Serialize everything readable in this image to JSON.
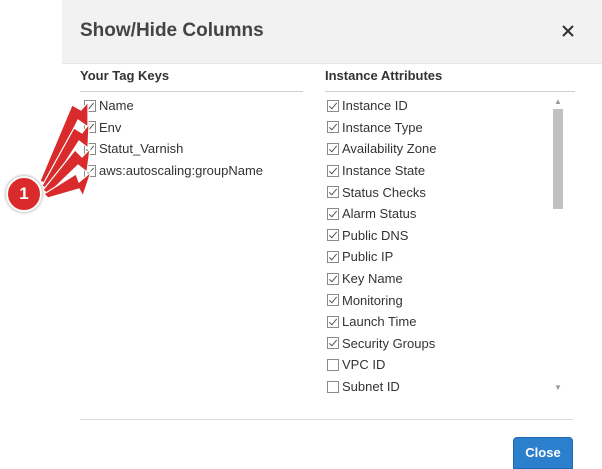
{
  "dialog": {
    "title": "Show/Hide Columns",
    "close_icon": "close-icon",
    "close_button_label": "Close"
  },
  "tag_keys": {
    "heading": "Your Tag Keys",
    "items": [
      {
        "label": "Name",
        "checked": true
      },
      {
        "label": "Env",
        "checked": true
      },
      {
        "label": "Statut_Varnish",
        "checked": true
      },
      {
        "label": "aws:autoscaling:groupName",
        "checked": true
      }
    ]
  },
  "instance_attributes": {
    "heading": "Instance Attributes",
    "items": [
      {
        "label": "Instance ID",
        "checked": true
      },
      {
        "label": "Instance Type",
        "checked": true
      },
      {
        "label": "Availability Zone",
        "checked": true
      },
      {
        "label": "Instance State",
        "checked": true
      },
      {
        "label": "Status Checks",
        "checked": true
      },
      {
        "label": "Alarm Status",
        "checked": true
      },
      {
        "label": "Public DNS",
        "checked": true
      },
      {
        "label": "Public IP",
        "checked": true
      },
      {
        "label": "Key Name",
        "checked": true
      },
      {
        "label": "Monitoring",
        "checked": true
      },
      {
        "label": "Launch Time",
        "checked": true
      },
      {
        "label": "Security Groups",
        "checked": true
      },
      {
        "label": "VPC ID",
        "checked": false
      },
      {
        "label": "Subnet ID",
        "checked": false
      }
    ]
  },
  "annotation": {
    "badge_number": "1",
    "color": "#d92b2b"
  },
  "colors": {
    "primary_button": "#2b7fcd",
    "header_bg": "#f2f2f2"
  }
}
